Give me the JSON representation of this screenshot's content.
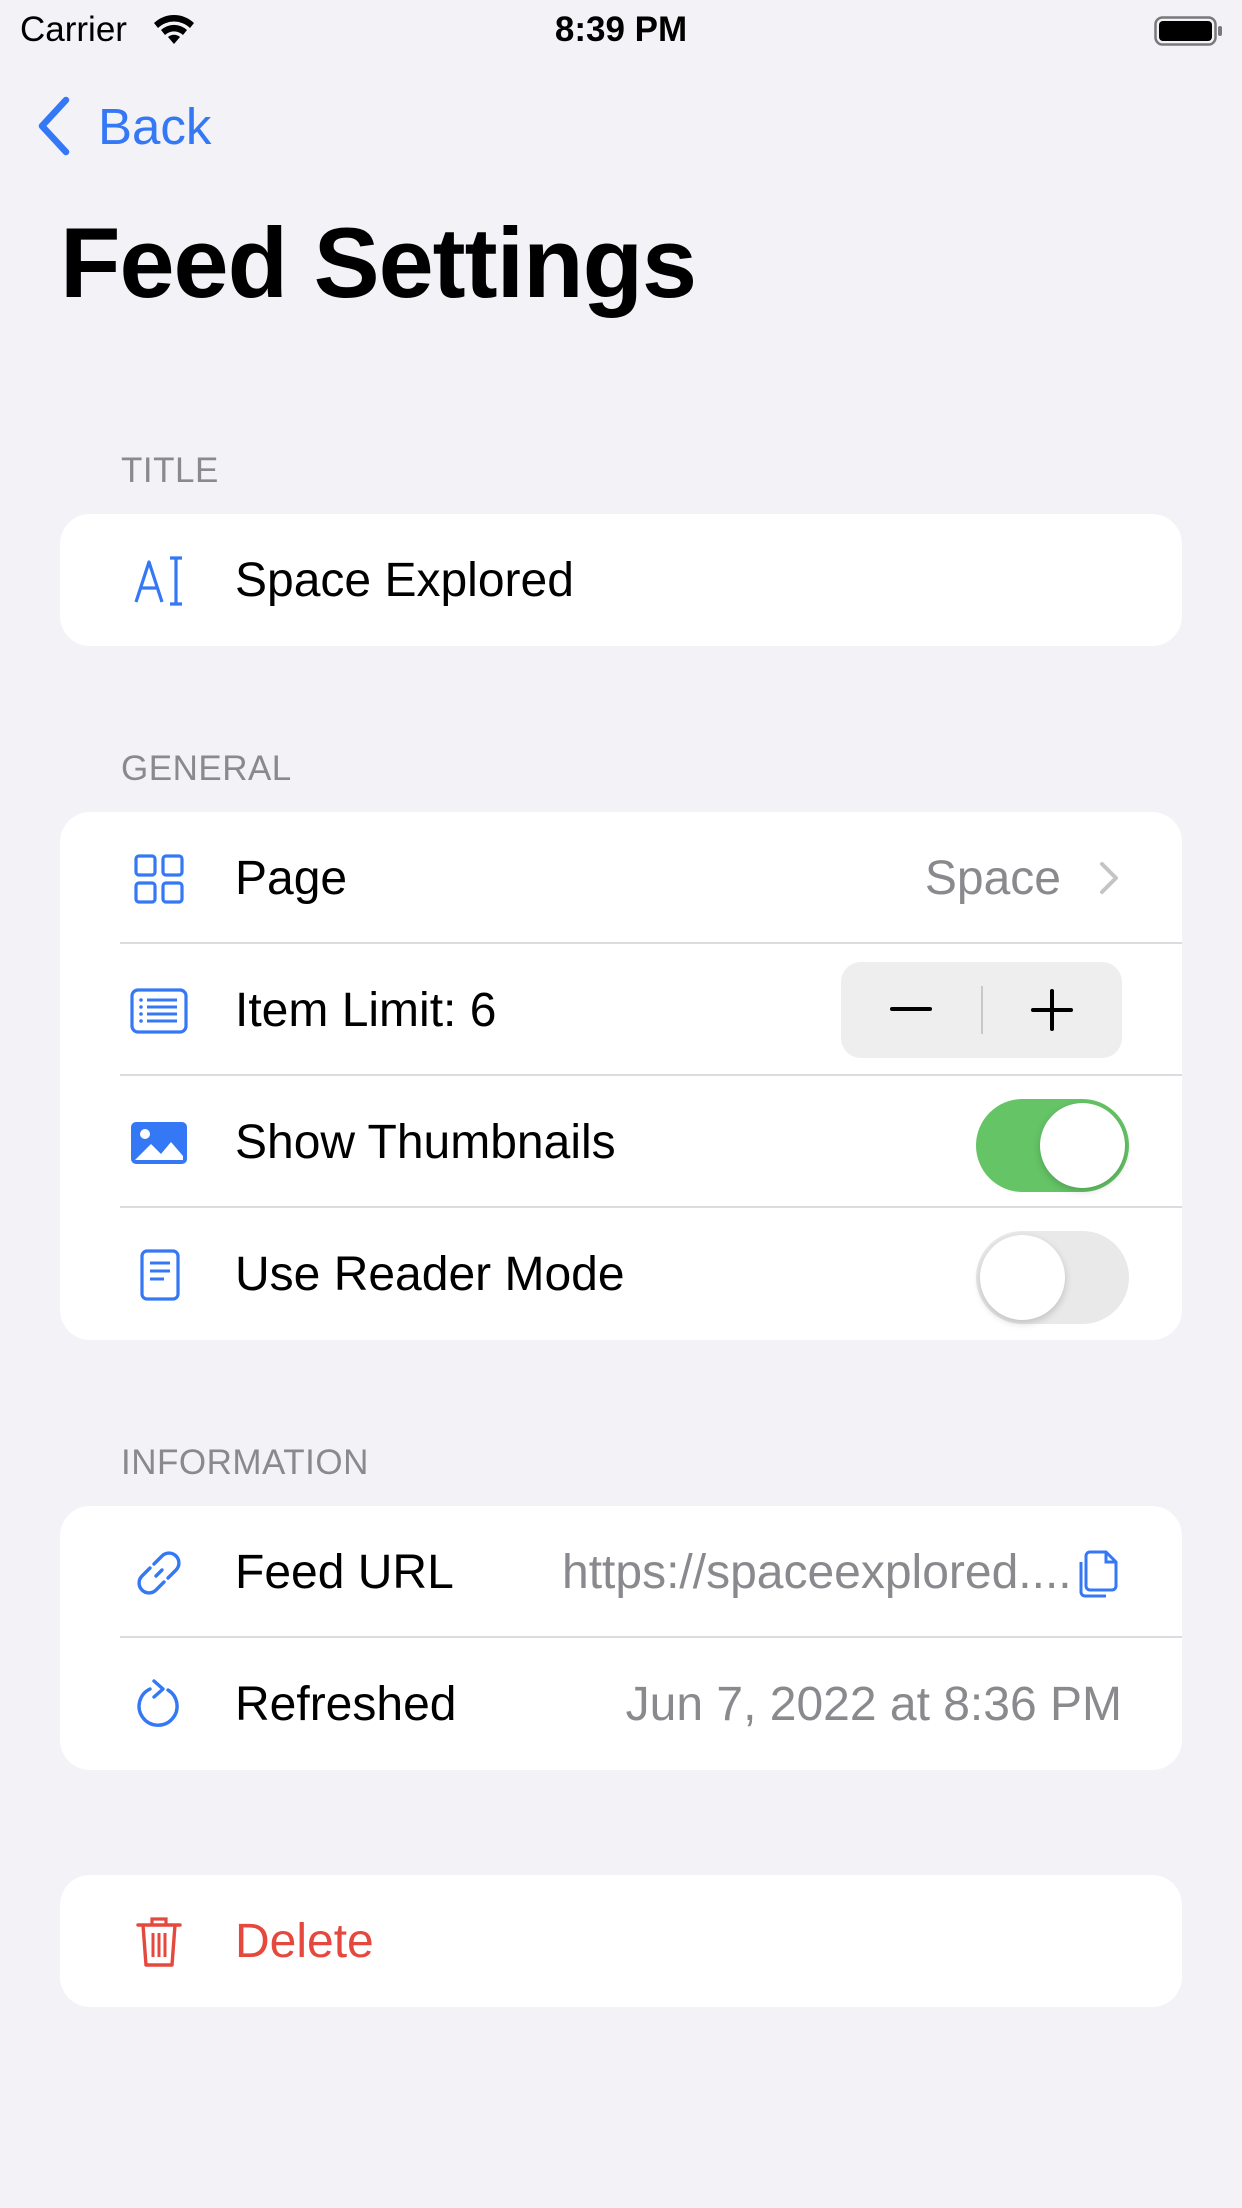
{
  "status_bar": {
    "carrier": "Carrier",
    "time": "8:39 PM"
  },
  "nav": {
    "back_label": "Back",
    "title": "Feed Settings"
  },
  "sections": {
    "title_header": "TITLE",
    "general_header": "GENERAL",
    "information_header": "INFORMATION"
  },
  "title_row": {
    "icon": "text-cursor-icon",
    "value": "Space Explored"
  },
  "general": {
    "page": {
      "icon": "grid-icon",
      "label": "Page",
      "value": "Space"
    },
    "item_limit": {
      "icon": "list-icon",
      "label": "Item Limit: 6"
    },
    "show_thumbnails": {
      "icon": "photo-icon",
      "label": "Show Thumbnails",
      "on": true
    },
    "reader_mode": {
      "icon": "document-icon",
      "label": "Use Reader Mode",
      "on": false
    }
  },
  "information": {
    "feed_url": {
      "icon": "link-icon",
      "label": "Feed URL",
      "value": "https://spaceexplored...."
    },
    "refreshed": {
      "icon": "refresh-icon",
      "label": "Refreshed",
      "value": "Jun 7, 2022 at 8:36 PM"
    }
  },
  "delete": {
    "icon": "trash-icon",
    "label": "Delete"
  },
  "colors": {
    "accent": "#3478f6",
    "toggle_on": "#65c466",
    "destructive": "#e5483d",
    "background": "#f2f2f7"
  }
}
